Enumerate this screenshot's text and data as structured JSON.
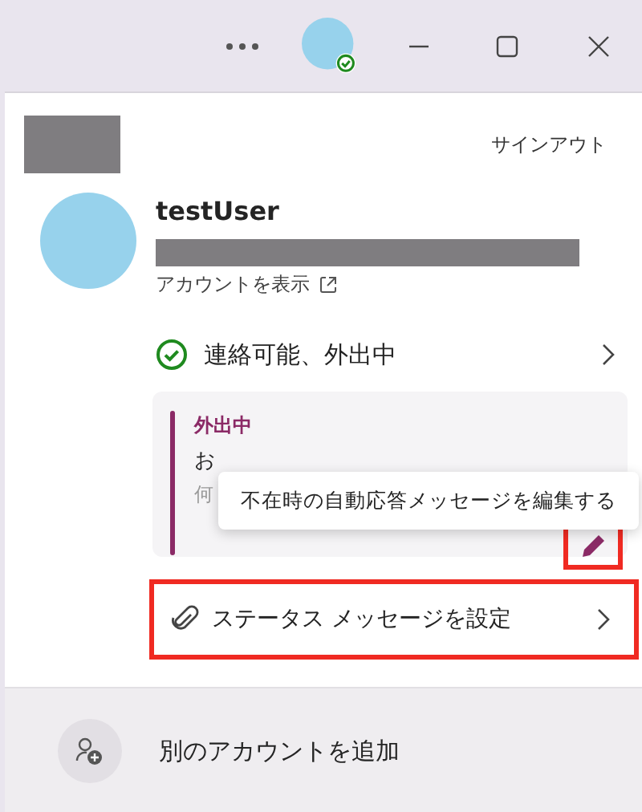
{
  "sign_out": "サインアウト",
  "user": {
    "name": "testUser",
    "view_account": "アカウントを表示"
  },
  "status": {
    "label": "連絡可能、外出中"
  },
  "note": {
    "title": "外出中",
    "line_1": "お",
    "line_2": "何"
  },
  "edit_button": {
    "highlighted": true
  },
  "tooltip": "不在時の自動応答メッセージを編集する",
  "set_status_message": {
    "label": "ステータス メッセージを設定",
    "highlighted": true
  },
  "add_account": "別のアカウントを追加"
}
